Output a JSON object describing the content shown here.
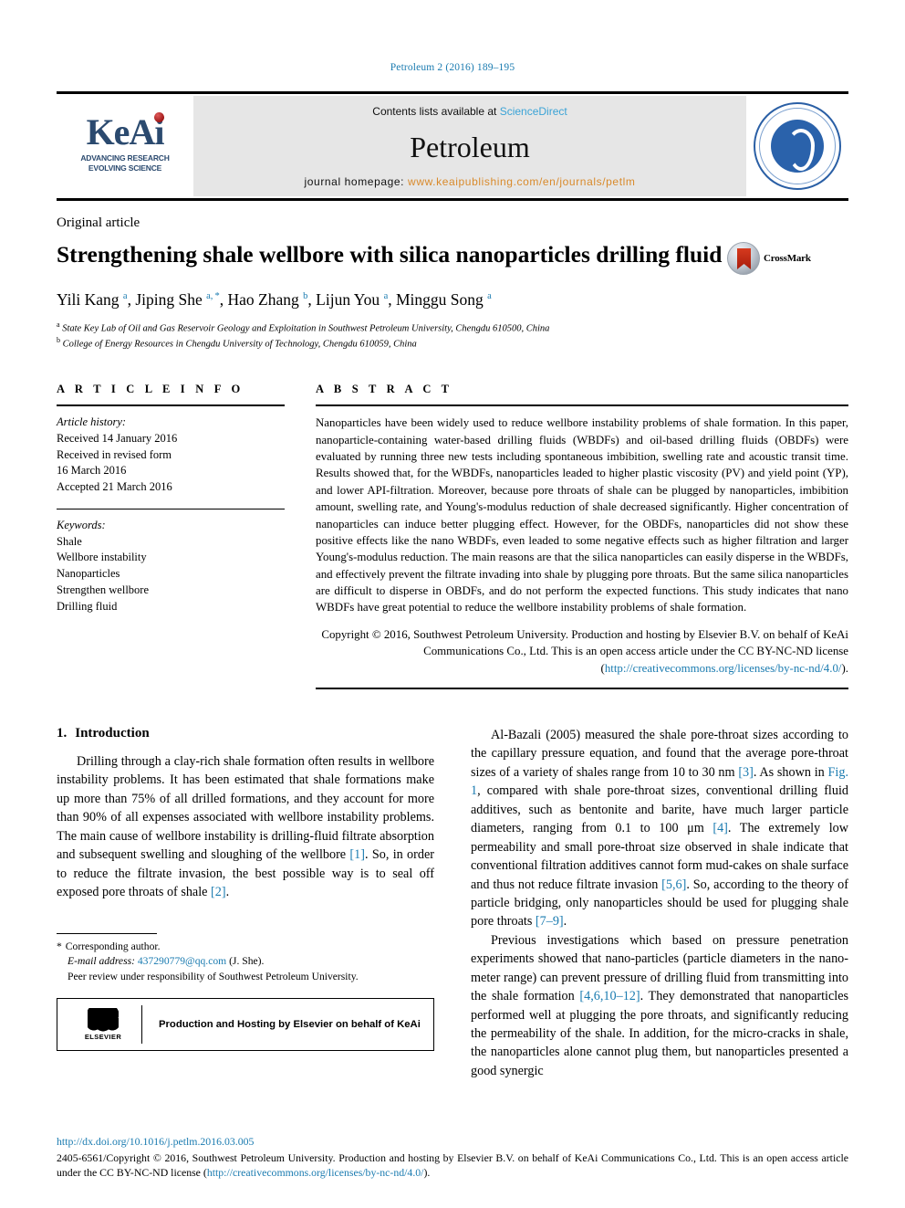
{
  "running_head": "Petroleum 2 (2016) 189–195",
  "masthead": {
    "logo_word": "KeAi",
    "logo_tagline_line1": "ADVANCING RESEARCH",
    "logo_tagline_line2": "EVOLVING SCIENCE",
    "contents_prefix": "Contents lists available at ",
    "contents_link": "ScienceDirect",
    "journal_name": "Petroleum",
    "homepage_prefix": "journal homepage: ",
    "homepage_url": "www.keaipublishing.com/en/journals/petlm",
    "seal_name": "southwest-petroleum-university-seal"
  },
  "article": {
    "type": "Original article",
    "title": "Strengthening shale wellbore with silica nanoparticles drilling fluid",
    "crossmark_label": "CrossMark",
    "authors_html": "Yili Kang <sup>a</sup>, Jiping She <sup>a, *</sup>, Hao Zhang <sup>b</sup>, Lijun You <sup>a</sup>, Minggu Song <sup>a</sup>",
    "affiliations": [
      "State Key Lab of Oil and Gas Reservoir Geology and Exploitation in Southwest Petroleum University, Chengdu 610500, China",
      "College of Energy Resources in Chengdu University of Technology, Chengdu 610059, China"
    ],
    "affiliation_marks": [
      "a",
      "b"
    ]
  },
  "article_info": {
    "heading": "A R T I C L E   I N F O",
    "history_label": "Article history:",
    "history": [
      "Received 14 January 2016",
      "Received in revised form",
      "16 March 2016",
      "Accepted 21 March 2016"
    ],
    "keywords_label": "Keywords:",
    "keywords": [
      "Shale",
      "Wellbore instability",
      "Nanoparticles",
      "Strengthen wellbore",
      "Drilling fluid"
    ]
  },
  "abstract": {
    "heading": "A B S T R A C T",
    "body": "Nanoparticles have been widely used to reduce wellbore instability problems of shale formation. In this paper, nanoparticle-containing water-based drilling fluids (WBDFs) and oil-based drilling fluids (OBDFs) were evaluated by running three new tests including spontaneous imbibition, swelling rate and acoustic transit time. Results showed that, for the WBDFs, nanoparticles leaded to higher plastic viscosity (PV) and yield point (YP), and lower API-filtration. Moreover, because pore throats of shale can be plugged by nanoparticles, imbibition amount, swelling rate, and Young's-modulus reduction of shale decreased significantly. Higher concentration of nanoparticles can induce better plugging effect. However, for the OBDFs, nanoparticles did not show these positive effects like the nano WBDFs, even leaded to some negative effects such as higher filtration and larger Young's-modulus reduction. The main reasons are that the silica nanoparticles can easily disperse in the WBDFs, and effectively prevent the filtrate invading into shale by plugging pore throats. But the same silica nanoparticles are difficult to disperse in OBDFs, and do not perform the expected functions. This study indicates that nano WBDFs have great potential to reduce the wellbore instability problems of shale formation.",
    "copyright_pre": "Copyright © 2016, Southwest Petroleum University. Production and hosting by Elsevier B.V. on behalf of KeAi Communications Co., Ltd. This is an open access article under the CC BY-NC-ND license (",
    "copyright_link": "http://creativecommons.org/licenses/by-nc-nd/4.0/",
    "copyright_post": ")."
  },
  "body": {
    "section1_num": "1.",
    "section1_title": "Introduction",
    "left_para1_parts": [
      "Drilling through a clay-rich shale formation often results in wellbore instability problems. It has been estimated that shale formations make up more than 75% of all drilled formations, and they account for more than 90% of all expenses associated with wellbore instability problems. The main cause of wellbore instability is drilling-fluid filtrate absorption and subsequent swelling and sloughing of the wellbore ",
      "[1]",
      ". So, in order to reduce the filtrate invasion, the best possible way is to seal off exposed pore throats of shale ",
      "[2]",
      "."
    ],
    "right_para1_parts": [
      "Al-Bazali (2005) measured the shale pore-throat sizes according to the capillary pressure equation, and found that the average pore-throat sizes of a variety of shales range from 10 to 30 nm ",
      "[3]",
      ". As shown in ",
      "Fig. 1",
      ", compared with shale pore-throat sizes, conventional drilling fluid additives, such as bentonite and barite, have much larger particle diameters, ranging from 0.1 to 100 μm ",
      "[4]",
      ". The extremely low permeability and small pore-throat size observed in shale indicate that conventional filtration additives cannot form mud-cakes on shale surface and thus not reduce filtrate invasion ",
      "[5,6]",
      ". So, according to the theory of particle bridging, only nanoparticles should be used for plugging shale pore throats ",
      "[7–9]",
      "."
    ],
    "right_para2_parts": [
      "Previous investigations which based on pressure penetration experiments showed that nano-particles (particle diameters in the nano-meter range) can prevent pressure of drilling fluid from transmitting into the shale formation ",
      "[4,6,10–12]",
      ". They demonstrated that nanoparticles performed well at plugging the pore throats, and significantly reducing the permeability of the shale. In addition, for the micro-cracks in shale, the nanoparticles alone cannot plug them, but nanoparticles presented a good synergic"
    ]
  },
  "footnote": {
    "star": "*",
    "corresponding": "Corresponding author.",
    "email_label": "E-mail address: ",
    "email": "437290779@qq.com",
    "email_suffix": " (J. She).",
    "peer_review": "Peer review under responsibility of Southwest Petroleum University.",
    "elsevier_word": "ELSEVIER",
    "production_text": "Production and Hosting by Elsevier on behalf of KeAi"
  },
  "page_footer": {
    "doi": "http://dx.doi.org/10.1016/j.petlm.2016.03.005",
    "text_pre": "2405-6561/Copyright © 2016, Southwest Petroleum University. Production and hosting by Elsevier B.V. on behalf of KeAi Communications Co., Ltd. This is an open access article under the CC BY-NC-ND license (",
    "link": "http://creativecommons.org/licenses/by-nc-nd/4.0/",
    "text_post": ")."
  },
  "colors": {
    "accent_blue": "#1a7bb0",
    "sciencedirect_blue": "#3aa3d6",
    "homepage_orange": "#d98a2b",
    "keai_navy": "#2b4a6f",
    "masthead_gray": "#e6e6e6"
  }
}
